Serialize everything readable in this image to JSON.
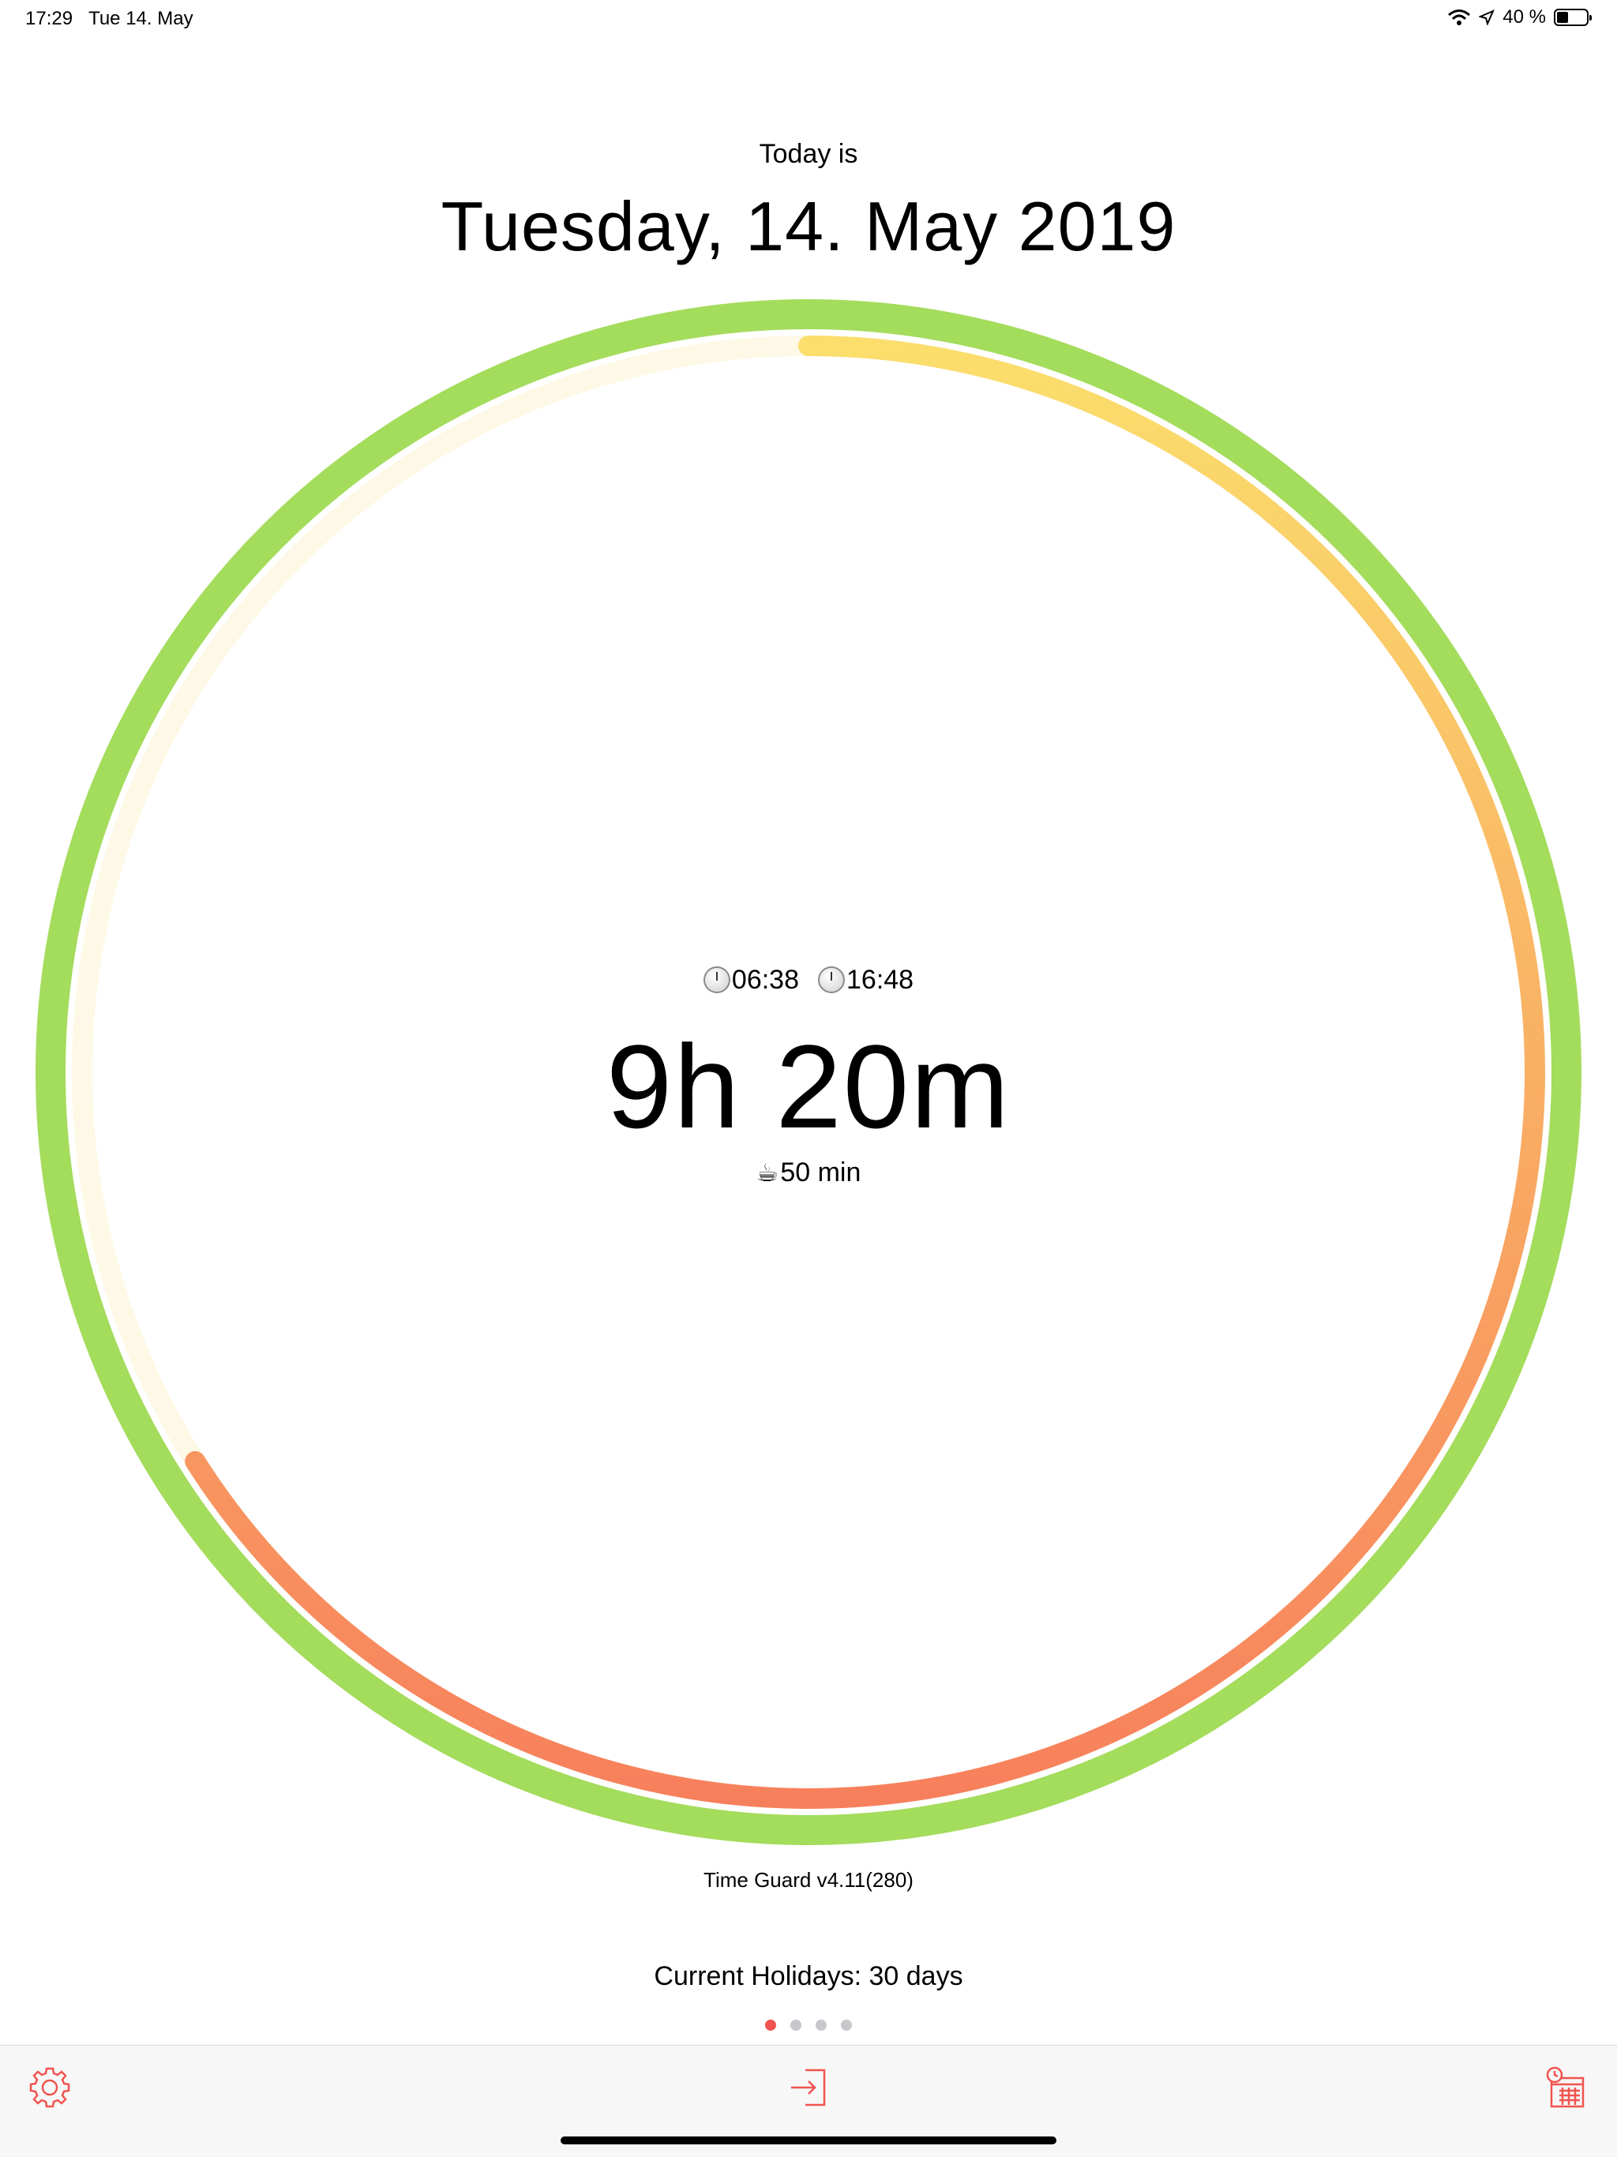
{
  "status_bar": {
    "time": "17:29",
    "date": "Tue 14. May",
    "battery_text": "40 %",
    "battery_level": 0.4
  },
  "header": {
    "today_label": "Today is",
    "date_title": "Tuesday, 14. May 2019"
  },
  "progress_ring": {
    "outer_color": "#a4dc5c",
    "track_color": "#fdf9e6",
    "gradient_start_color": "#fbde6c",
    "gradient_end_color": "#f7805c",
    "progress_fraction": 0.66
  },
  "center": {
    "start_time": "06:38",
    "end_time": "16:48",
    "duration": "9h 20m",
    "break": "50 min",
    "start_icon": "clock-icon",
    "end_icon": "clock-icon",
    "break_icon": "coffee-icon"
  },
  "version": "Time Guard v4.11(280)",
  "holidays": "Current Holidays: 30 days",
  "pager": {
    "count": 4,
    "active_index": 0
  },
  "toolbar": {
    "left_icon": "settings-gear-icon",
    "center_icon": "check-in-icon",
    "right_icon": "calendar-clock-icon",
    "accent_color": "#f0544f"
  }
}
